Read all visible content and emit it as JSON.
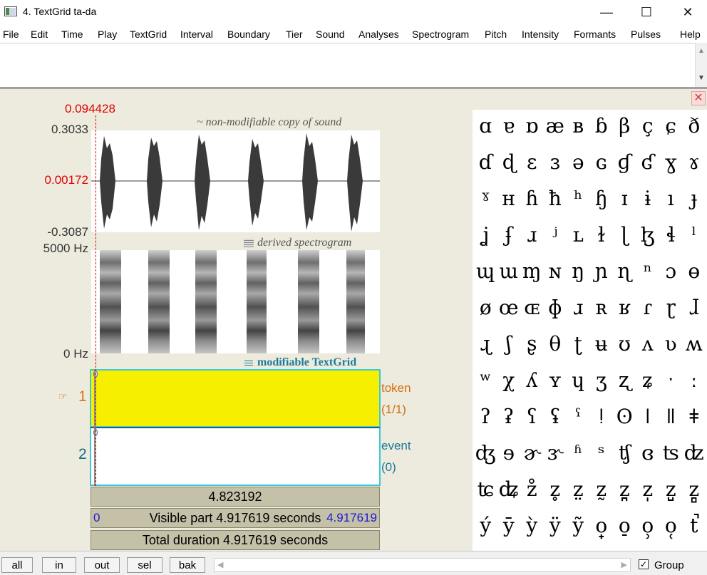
{
  "window": {
    "title": "4. TextGrid ta-da",
    "minimize_icon": "minimize-icon",
    "maximize_icon": "maximize-icon",
    "close_icon": "close-icon"
  },
  "menu": [
    "File",
    "Edit",
    "Time",
    "Play",
    "TextGrid",
    "Interval",
    "Boundary",
    "Tier",
    "Sound",
    "Analyses",
    "Spectrogram",
    "Pitch",
    "Intensity",
    "Formants",
    "Pulses",
    "Help"
  ],
  "editor": {
    "cursor_time": "0.094428",
    "sound": {
      "max": "0.3033",
      "cursor_value": "0.00172",
      "min": "-0.3087",
      "note": "~ non-modifiable copy of sound"
    },
    "spectrogram": {
      "top": "5000 Hz",
      "bottom": "0 Hz",
      "note": "derived spectrogram"
    },
    "textgrid_note": "modifiable TextGrid",
    "tiers": [
      {
        "number": "1",
        "name": "token",
        "count": "(1/1)",
        "selected": true
      },
      {
        "number": "2",
        "name": "event",
        "count": "(0)",
        "selected": false
      }
    ],
    "interval_duration": "4.823192",
    "visible_start": "0",
    "visible_label": "Visible part 4.917619 seconds",
    "visible_end": "4.917619",
    "total_label": "Total duration 4.917619 seconds"
  },
  "ipa_rows": [
    [
      "ɑ",
      "ɐ",
      "ɒ",
      "æ",
      "ʙ",
      "ɓ",
      "β",
      "ç",
      "ɕ",
      "ð"
    ],
    [
      "ɗ",
      "ɖ",
      "ɛ",
      "ɜ",
      "ə",
      "ɢ",
      "ɠ",
      "ʛ",
      "ɣ",
      "ɤ"
    ],
    [
      "ˠ",
      "ʜ",
      "ɦ",
      "ħ",
      "ʰ",
      "ɧ",
      "ɪ",
      "ɨ",
      "ı",
      "ɟ"
    ],
    [
      "ʝ",
      "ʄ",
      "ɹ",
      "ʲ",
      "ʟ",
      "ɫ",
      "ɭ",
      "ɮ",
      "ɬ",
      "ˡ"
    ],
    [
      "ɰ",
      "ɯ",
      "ɱ",
      "ɴ",
      "ŋ",
      "ɲ",
      "ɳ",
      "ⁿ",
      "ɔ",
      "ɵ"
    ],
    [
      "ø",
      "œ",
      "ɶ",
      "ɸ",
      "ɹ",
      "ʀ",
      "ʁ",
      "ɾ",
      "ɽ",
      "ɺ"
    ],
    [
      "ɻ",
      "ʃ",
      "ʂ",
      "θ",
      "ʈ",
      "ʉ",
      "ʊ",
      "ʌ",
      "ʋ",
      "ʍ"
    ],
    [
      "ʷ",
      "χ",
      "ʎ",
      "ʏ",
      "ɥ",
      "ʒ",
      "ʐ",
      "ʑ",
      "ˑ",
      "ː"
    ],
    [
      "ʔ",
      "ʡ",
      "ʕ",
      "ʢ",
      "ˤ",
      "ǃ",
      "ʘ",
      "ǀ",
      "ǁ",
      "ǂ"
    ],
    [
      "ʤ",
      "ɘ",
      "ɚ",
      "ɝ",
      "ʱ",
      "ˢ",
      "ʧ",
      "ɞ",
      "ʦ",
      "ʣ"
    ],
    [
      "ʨ",
      "ʥ",
      "z̊",
      "z̥",
      "z̤",
      "z̰",
      "z̪",
      "z̩",
      "z̺",
      "z̻"
    ],
    [
      "ý",
      "ȳ",
      "ỳ",
      "ÿ",
      "ỹ",
      "o̟",
      "o̠",
      "o̹",
      "o̜",
      "t̚"
    ]
  ],
  "toolbar": {
    "buttons": [
      "all",
      "in",
      "out",
      "sel",
      "bak"
    ],
    "group_label": "Group",
    "group_checked": true
  }
}
